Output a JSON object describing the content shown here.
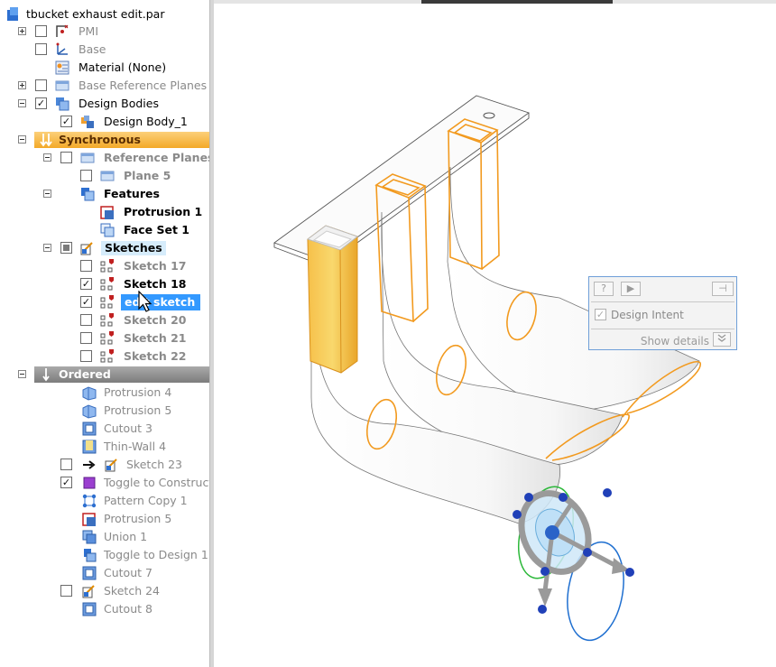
{
  "file_title": "tbucket exhaust edit.par",
  "tree": {
    "pmi": "PMI",
    "base": "Base",
    "material": "Material (None)",
    "base_ref_planes": "Base Reference Planes",
    "design_bodies": "Design Bodies",
    "design_body_1": "Design Body_1",
    "synchronous": "Synchronous",
    "reference_planes": "Reference Planes",
    "plane_5": "Plane 5",
    "features": "Features",
    "protrusion_1": "Protrusion 1",
    "face_set_1": "Face Set 1",
    "sketches": "Sketches",
    "sketch_17": "Sketch 17",
    "sketch_18": "Sketch 18",
    "edit_sketch": "edit sketch",
    "sketch_20": "Sketch 20",
    "sketch_21": "Sketch 21",
    "sketch_22": "Sketch 22",
    "ordered": "Ordered",
    "protrusion_4": "Protrusion 4",
    "protrusion_5a": "Protrusion 5",
    "cutout_3": "Cutout 3",
    "thin_wall_4": "Thin-Wall 4",
    "sketch_23": "Sketch 23",
    "toggle_construct": "Toggle to Construct",
    "pattern_copy_1": "Pattern Copy 1",
    "protrusion_5b": "Protrusion 5",
    "union_1": "Union 1",
    "toggle_design_1": "Toggle to Design 1",
    "cutout_7": "Cutout 7",
    "sketch_24": "Sketch 24",
    "cutout_8": "Cutout 8"
  },
  "dialog": {
    "help": "?",
    "play": "▶",
    "pin": "⊣",
    "design_intent": "Design Intent",
    "show_details": "Show details"
  },
  "colors": {
    "synchronous_band": "#f6b73c",
    "ordered_band": "#8c8c8c",
    "selection": "#3399ff",
    "highlight": "#f29a1f",
    "dialog_border": "#6f9fd8"
  }
}
